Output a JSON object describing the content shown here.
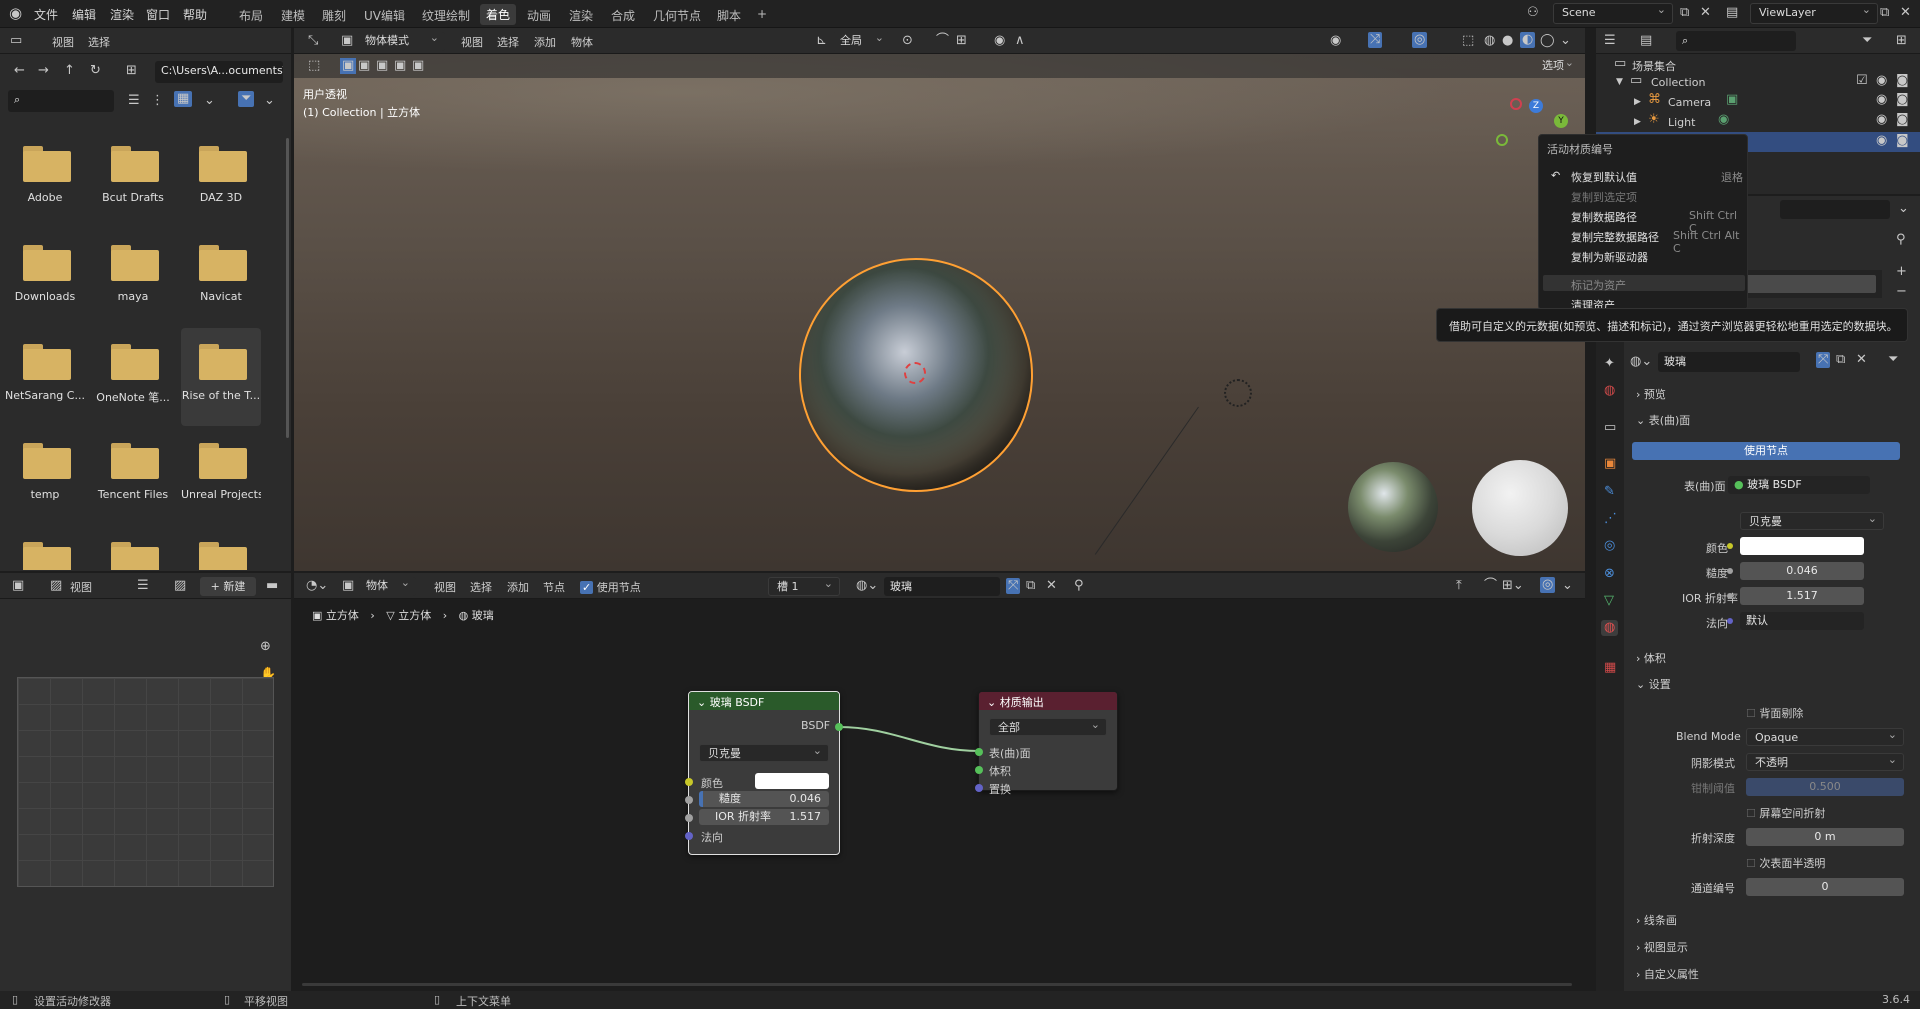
{
  "menu": {
    "file": "文件",
    "edit": "编辑",
    "render": "渲染",
    "window": "窗口",
    "help": "帮助"
  },
  "workspaces": [
    "布局",
    "建模",
    "雕刻",
    "UV编辑",
    "纹理绘制",
    "着色",
    "动画",
    "渲染",
    "合成",
    "几何节点",
    "脚本"
  ],
  "active_workspace": "着色",
  "scene": "Scene",
  "view_layer": "ViewLayer",
  "filebrowser": {
    "menus": [
      "视图",
      "选择"
    ],
    "path": "C:\\Users\\A...ocuments\\",
    "folders": [
      "Adobe",
      "Bcut Drafts",
      "DAZ 3D",
      "Downloads",
      "maya",
      "Navicat",
      "NetSarang C...",
      "OneNote 笔...",
      "Rise of the T...",
      "temp",
      "Tencent Files",
      "Unreal Projects"
    ]
  },
  "imageeditor": {
    "menu": "视图",
    "new": "新建"
  },
  "viewport": {
    "mode": "物体模式",
    "menus": [
      "视图",
      "选择",
      "添加",
      "物体"
    ],
    "orient": "全局",
    "view_name": "用户透视",
    "collection_info": "(1) Collection | 立方体",
    "options": "选项",
    "gizmo": {
      "x": "X",
      "y": "Y",
      "z": "Z"
    }
  },
  "outliner": {
    "root": "场景集合",
    "collection": "Collection",
    "items": [
      "Camera",
      "Light"
    ]
  },
  "context_menu": {
    "title": "活动材质编号",
    "items": [
      {
        "label": "恢复到默认值",
        "shortcut": "退格"
      },
      {
        "label": "复制到选定项",
        "shortcut": ""
      },
      {
        "label": "复制数据路径",
        "shortcut": "Shift Ctrl C"
      },
      {
        "label": "复制完整数据路径",
        "shortcut": "Shift Ctrl Alt C"
      },
      {
        "label": "复制为新驱动器",
        "shortcut": ""
      },
      {
        "label": "标记为资产",
        "shortcut": ""
      },
      {
        "label": "清理资产",
        "shortcut": ""
      }
    ]
  },
  "tooltip": "借助可自定义的元数据(如预览、描述和标记)，通过资产浏览器更轻松地重用选定的数据块。",
  "properties": {
    "material": "玻璃",
    "sections": {
      "preview": "预览",
      "surface": "表(曲)面",
      "volume": "体积",
      "settings": "设置",
      "lineart": "线条画",
      "viewport_display": "视图显示",
      "custom_props": "自定义属性"
    },
    "use_nodes": "使用节点",
    "surface_label": "表(曲)面",
    "surface_value": "玻璃 BSDF",
    "distribution": "贝克曼",
    "color_label": "颜色",
    "roughness_label": "糙度",
    "roughness": "0.046",
    "ior_label": "IOR 折射率",
    "ior": "1.517",
    "normal_label": "法向",
    "normal": "默认",
    "backface": "背面剔除",
    "blend_label": "Blend Mode",
    "blend": "Opaque",
    "shadow_label": "阴影模式",
    "shadow": "不透明",
    "clip_label": "钳制阈值",
    "clip": "0.500",
    "ssr": "屏幕空间折射",
    "refr_depth_label": "折射深度",
    "refr_depth": "0 m",
    "sss": "次表面半透明",
    "pass_label": "通道编号",
    "pass_index": "0"
  },
  "node_editor": {
    "mode": "物体",
    "menus": [
      "视图",
      "选择",
      "添加",
      "节点"
    ],
    "use_nodes": "使用节点",
    "slot": "槽 1",
    "material": "玻璃",
    "breadcrumb": [
      "立方体",
      "立方体",
      "玻璃"
    ],
    "glass_node": {
      "title": "玻璃 BSDF",
      "output": "BSDF",
      "distribution": "贝克曼",
      "color": "颜色",
      "roughness_label": "糙度",
      "roughness": "0.046",
      "ior_label": "IOR 折射率",
      "ior": "1.517",
      "normal": "法向"
    },
    "output_node": {
      "title": "材质输出",
      "target": "全部",
      "inputs": [
        "表(曲)面",
        "体积",
        "置换"
      ]
    }
  },
  "statusbar": {
    "left": "设置活动修改器",
    "mid": "平移视图",
    "right": "上下文菜单",
    "version": "3.6.4"
  },
  "colors": {
    "accent": "#4772b3",
    "selection": "#ffa033",
    "shader_header": "#2a5a2a",
    "output_header": "#5a2030"
  }
}
